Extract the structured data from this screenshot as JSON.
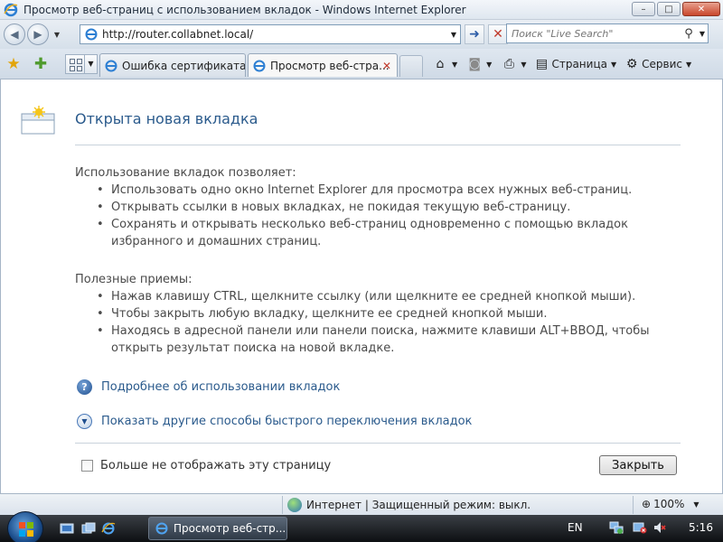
{
  "window": {
    "title": "Просмотр веб-страниц с использованием вкладок - Windows Internet Explorer",
    "buttons": {
      "minimize": "–",
      "maximize": "□",
      "close": "✕"
    }
  },
  "address_bar": {
    "url": "http://router.collabnet.local/",
    "search_placeholder": "Поиск \"Live Search\""
  },
  "tabs": [
    {
      "label": "Ошибка сертификата: ...",
      "active": false
    },
    {
      "label": "Просмотр веб-стра...",
      "active": true
    }
  ],
  "command_bar": {
    "page_label": "Страница",
    "tools_label": "Сервис"
  },
  "content": {
    "heading": "Открыта новая вкладка",
    "section1": {
      "intro": "Использование вкладок позволяет:",
      "items": [
        "Использовать одно окно Internet Explorer для просмотра всех нужных веб-страниц.",
        "Открывать ссылки в новых вкладках, не покидая текущую веб-страницу.",
        "Сохранять и открывать несколько веб-страниц одновременно с помощью вкладок избранного и домашних страниц."
      ]
    },
    "section2": {
      "intro": "Полезные приемы:",
      "items": [
        "Нажав клавишу CTRL, щелкните ссылку (или щелкните ее средней кнопкой мыши).",
        "Чтобы закрыть любую вкладку, щелкните ее средней кнопкой мыши.",
        "Находясь в адресной панели или панели поиска, нажмите клавиши ALT+ВВОД, чтобы открыть результат поиска на новой вкладке."
      ]
    },
    "link_more": "Подробнее об использовании вкладок",
    "link_switch": "Показать другие способы быстрого переключения вкладок",
    "checkbox_label": "Больше не отображать эту страницу",
    "checkbox_checked": false,
    "close_button": "Закрыть"
  },
  "status_bar": {
    "zone": "Интернет | Защищенный режим: выкл.",
    "zoom": "100%"
  },
  "taskbar": {
    "task_label": "Просмотр веб-стр...",
    "language": "EN",
    "clock": "5:16"
  },
  "colors": {
    "link": "#2a5a8c",
    "heading": "#2a5a8c",
    "close_button_red": "#c9462b"
  }
}
